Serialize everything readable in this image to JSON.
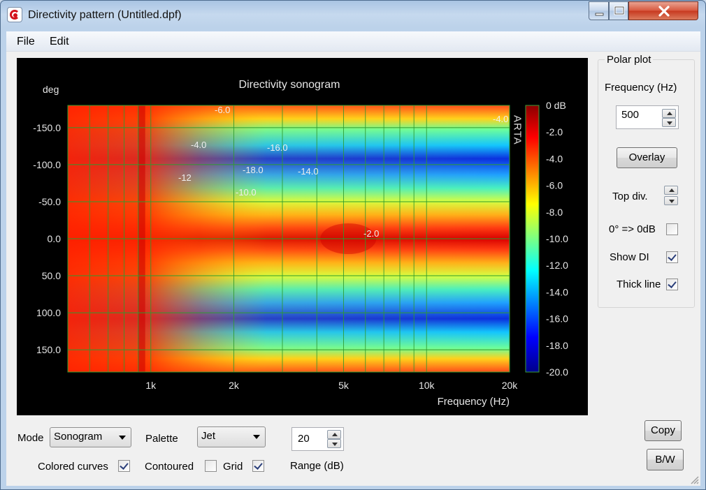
{
  "window": {
    "title": "Directivity pattern (Untitled.dpf)"
  },
  "menu": {
    "file": "File",
    "edit": "Edit"
  },
  "plot": {
    "title": "Directivity sonogram",
    "y_unit": "deg",
    "y_ticks": [
      "-150.0",
      "-100.0",
      "-50.0",
      "0.0",
      "50.0",
      "100.0",
      "150.0"
    ],
    "x_ticks": [
      "1k",
      "2k",
      "5k",
      "10k",
      "20k"
    ],
    "x_label": "Frequency (Hz)",
    "watermark": "ARTA",
    "colorbar_ticks": [
      "0 dB",
      "-2.0",
      "-4.0",
      "-6.0",
      "-8.0",
      "-10.0",
      "-12.0",
      "-14.0",
      "-16.0",
      "-18.0",
      "-20.0"
    ],
    "contour_labels": [
      "-6.0",
      "-4.0",
      "-16.0",
      "-18.0",
      "-14.0",
      "-10.0",
      "-12",
      "-2.0",
      "-4.0"
    ]
  },
  "chart_data": {
    "type": "heatmap",
    "title": "Directivity sonogram",
    "xlabel": "Frequency (Hz)",
    "ylabel": "deg",
    "x_scale": "log",
    "xlim": [
      500,
      20000
    ],
    "ylim": [
      -180,
      180
    ],
    "zlim": [
      -20,
      0
    ],
    "z_unit": "dB",
    "palette": "Jet",
    "grid": true,
    "x_ticks": [
      1000,
      2000,
      5000,
      10000,
      20000
    ],
    "y_ticks": [
      -150,
      -100,
      -50,
      0,
      50,
      100,
      150
    ],
    "colorbar_ticks": [
      0,
      -2,
      -4,
      -6,
      -8,
      -10,
      -12,
      -14,
      -16,
      -18,
      -20
    ]
  },
  "polar": {
    "group_title": "Polar plot",
    "frequency_label": "Frequency (Hz)",
    "frequency_value": "500",
    "overlay": "Overlay",
    "top_div": "Top div.",
    "zero_db": "0° => 0dB",
    "zero_db_checked": false,
    "show_di": "Show DI",
    "show_di_checked": true,
    "thick_line": "Thick line",
    "thick_line_checked": true
  },
  "controls": {
    "mode_label": "Mode",
    "mode_value": "Sonogram",
    "palette_label": "Palette",
    "palette_value": "Jet",
    "range_value": "20",
    "range_label": "Range (dB)",
    "colored_curves": "Colored curves",
    "colored_curves_checked": true,
    "contoured": "Contoured",
    "contoured_checked": false,
    "grid": "Grid",
    "grid_checked": true,
    "copy": "Copy",
    "bw": "B/W"
  }
}
